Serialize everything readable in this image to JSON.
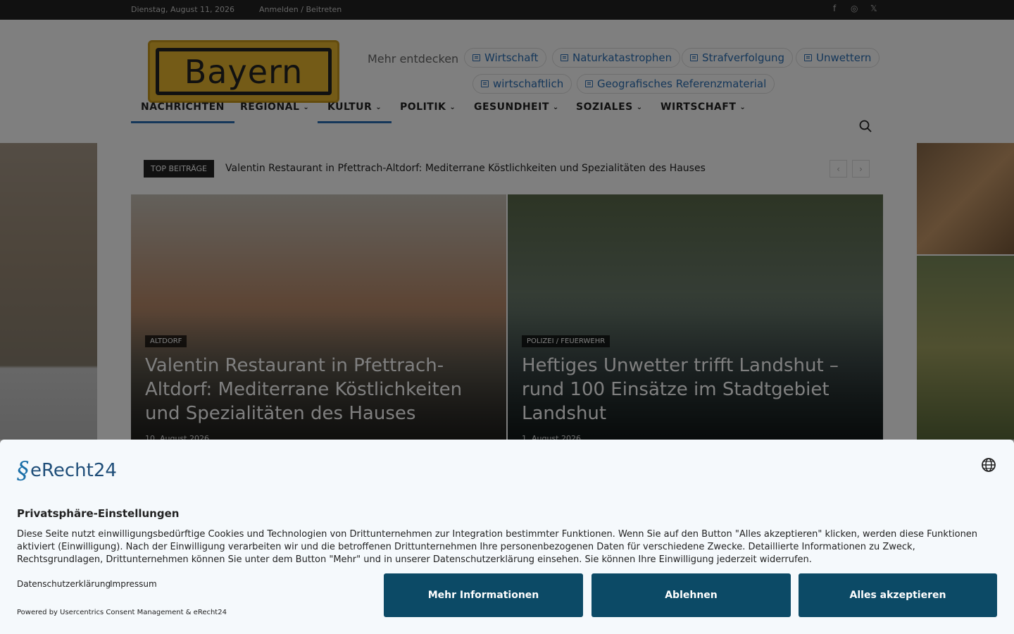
{
  "topbar": {
    "date": "Dienstag, August 11, 2026",
    "login": "Anmelden / Beitreten",
    "social": [
      "f",
      "◎",
      "𝕏"
    ]
  },
  "header": {
    "logo_text": "Bayern",
    "discover_label": "Mehr entdecken",
    "pills": [
      "Wirtschaft",
      "Naturkatastrophen",
      "Strafverfolgung",
      "Unwettern",
      "wirtschaftlich",
      "Geografisches Referenzmaterial"
    ]
  },
  "nav": {
    "items": [
      {
        "label": "NACHRICHTEN",
        "chev": ""
      },
      {
        "label": "REGIONAL",
        "chev": "⌄"
      },
      {
        "label": "KULTUR",
        "chev": "⌄"
      },
      {
        "label": "POLITIK",
        "chev": "⌄"
      },
      {
        "label": "GESUNDHEIT",
        "chev": "⌄"
      },
      {
        "label": "SOZIALES",
        "chev": "⌄"
      },
      {
        "label": "WIRTSCHAFT",
        "chev": "⌄"
      }
    ]
  },
  "ticker": {
    "tag": "TOP BEITRÄGE",
    "text": "Valentin Restaurant in Pfettrach-Altdorf: Mediterrane Köstlichkeiten und Spezialitäten des Hauses",
    "prev": "‹",
    "next": "›"
  },
  "cards": [
    {
      "category": "ALTDORF",
      "title": "Valentin Restaurant in Pfettrach-Altdorf: Mediterrane Köstlichkeiten und Spezialitäten des Hauses",
      "date": "10. August 2026"
    },
    {
      "category": "POLIZEI / FEUERWEHR",
      "title": "Heftiges Unwetter trifft Landshut – rund 100 Einsätze im Stadtgebiet Landshut",
      "date": "1. August 2026"
    }
  ],
  "consent": {
    "brand_mark": "§",
    "brand_name": "eRecht24",
    "heading": "Privatsphäre-Einstellungen",
    "description": "Diese Seite nutzt einwilligungsbedürftige Cookies und Technologien von Drittunternehmen zur Integration bestimmter Funktionen. Wenn Sie auf den Button \"Alles akzeptieren\" klicken, werden diese Funktionen aktiviert (Einwilligung). Nach der Einwilligung verarbeiten wir und die betroffenen Drittunternehmen Ihre personenbezogenen Daten für verschiedene Zwecke. Detaillierte Informationen zu Zweck, Rechtsgrundlagen, Drittunternehmen können Sie unter dem Button \"Mehr\" und in unserer Datenschutzerklärung einsehen. Sie können Ihre Einwilligung jederzeit widerrufen.",
    "privacy_link": "Datenschutzerklärung",
    "imprint_link": "Impressum",
    "powered": "Powered by Usercentrics Consent Management & eRecht24",
    "more_button": "Mehr Informationen",
    "decline_button": "Ablehnen",
    "accept_button": "Alles akzeptieren"
  },
  "colors": {
    "accent": "#2a6fb5",
    "button": "#0c4a66",
    "logo": "#e8b62e"
  }
}
